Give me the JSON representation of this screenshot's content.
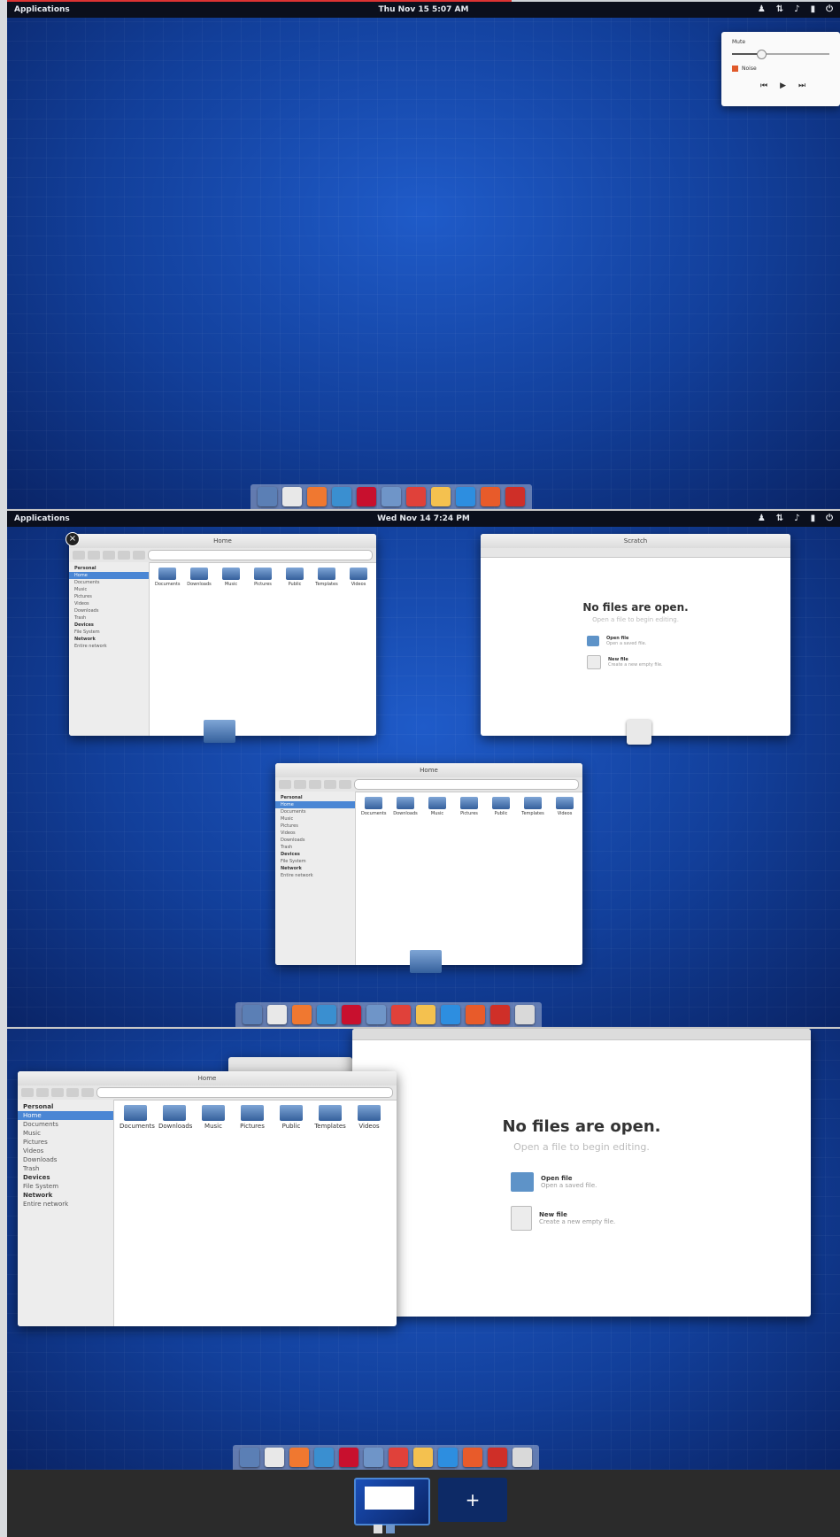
{
  "colors": {
    "panel": "#0b0f1c",
    "desktop": "#1a4fb8",
    "selection": "#4a86d4",
    "bottom_bar": "#2b2b2b",
    "new_workspace": "#0d2a66"
  },
  "screen1": {
    "panel": {
      "apps": "Applications",
      "clock": "Thu Nov 15 5:07 AM"
    },
    "indicators": [
      "user-icon",
      "network-icon",
      "sound-icon",
      "battery-icon",
      "power-icon"
    ],
    "sound_popover": {
      "label": "Mute",
      "volume_fraction": 0.3,
      "now_playing": "Noise",
      "controls": [
        "previous-icon",
        "play-icon",
        "next-icon"
      ]
    }
  },
  "screen2": {
    "panel": {
      "apps": "Applications",
      "clock": "Wed Nov 14 7:24 PM"
    },
    "files_window": {
      "title": "Home",
      "sidebar": {
        "personal_header": "Personal",
        "personal": [
          "Home",
          "Documents",
          "Music",
          "Pictures",
          "Videos",
          "Downloads",
          "Trash"
        ],
        "devices_header": "Devices",
        "devices": [
          "File System"
        ],
        "network_header": "Network",
        "network": [
          "Entire network"
        ]
      },
      "items": [
        "Documents",
        "Downloads",
        "Music",
        "Pictures",
        "Public",
        "Templates",
        "Videos"
      ]
    },
    "editor_window": {
      "title": "Scratch",
      "heading": "No files are open.",
      "subheading": "Open a file to begin editing.",
      "open_title": "Open file",
      "open_sub": "Open a saved file.",
      "new_title": "New file",
      "new_sub": "Create a new empty file."
    }
  },
  "screen3": {
    "files_window": {
      "title": "Home"
    },
    "editor_window": {
      "heading": "No files are open.",
      "subheading": "Open a file to begin editing.",
      "open_title": "Open file",
      "open_sub": "Open a saved file.",
      "new_title": "New file",
      "new_sub": "Create a new empty file."
    },
    "workspace_switcher": {
      "add_label": "+"
    }
  },
  "dock_icons": [
    {
      "name": "multitasking-icon",
      "color": "#5b7fb5"
    },
    {
      "name": "web-browser-icon",
      "color": "#e8e8e8"
    },
    {
      "name": "music-icon",
      "color": "#f07830"
    },
    {
      "name": "chat-icon",
      "color": "#3a8fd0"
    },
    {
      "name": "video-icon",
      "color": "#c8102e"
    },
    {
      "name": "files-icon",
      "color": "#6f95c8"
    },
    {
      "name": "calendar-icon",
      "color": "#e0413a"
    },
    {
      "name": "notes-icon",
      "color": "#f4c14f"
    },
    {
      "name": "app-center-icon",
      "color": "#2d8ee0"
    },
    {
      "name": "photos-icon",
      "color": "#e85b2a"
    },
    {
      "name": "store-icon",
      "color": "#cf2f28"
    },
    {
      "name": "text-editor-icon",
      "color": "#d9d9d9"
    }
  ]
}
